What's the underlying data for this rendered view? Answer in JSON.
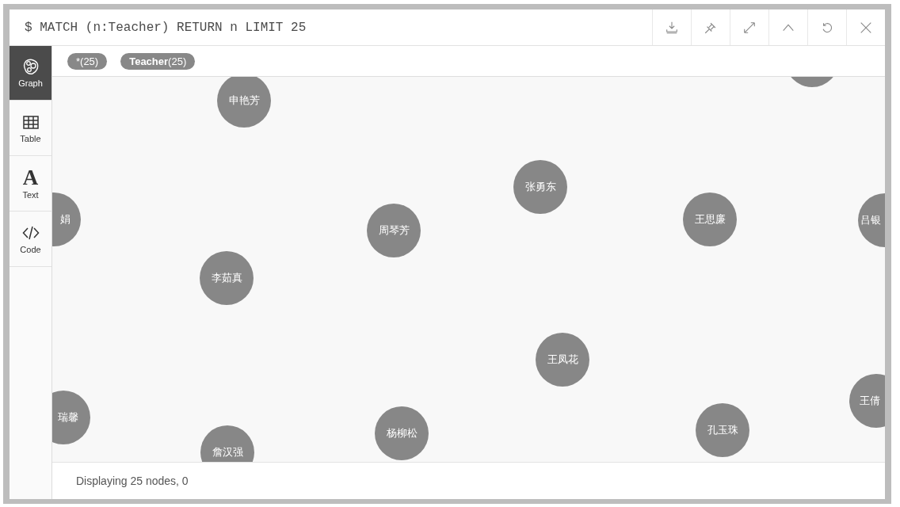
{
  "query": {
    "text": "$ MATCH (n:Teacher) RETURN n LIMIT 25"
  },
  "sidebar": {
    "items": [
      {
        "kind": "graph",
        "label": "Graph",
        "selected": true
      },
      {
        "kind": "table",
        "label": "Table",
        "selected": false
      },
      {
        "kind": "text",
        "glyph": "A",
        "label": "Text",
        "selected": false
      },
      {
        "kind": "code",
        "label": "Code",
        "selected": false
      }
    ]
  },
  "labels": [
    {
      "text": "*(25)"
    },
    {
      "text": "**Teacher**(25)"
    }
  ],
  "graph": {
    "nodes": [
      {
        "label": "申艳芳"
      },
      {
        "label": "张勇东"
      },
      {
        "label": "娟"
      },
      {
        "label": "王思廉"
      },
      {
        "label": "吕银"
      },
      {
        "label": "周琴芳"
      },
      {
        "label": "李茹真"
      },
      {
        "label": "王凤花"
      },
      {
        "label": "瑞馨"
      },
      {
        "label": "王倩"
      },
      {
        "label": "孔玉珠"
      },
      {
        "label": "杨柳松"
      },
      {
        "label": "詹汉强"
      }
    ]
  },
  "status_bar": {
    "text": "Displaying 25 nodes, 0"
  }
}
